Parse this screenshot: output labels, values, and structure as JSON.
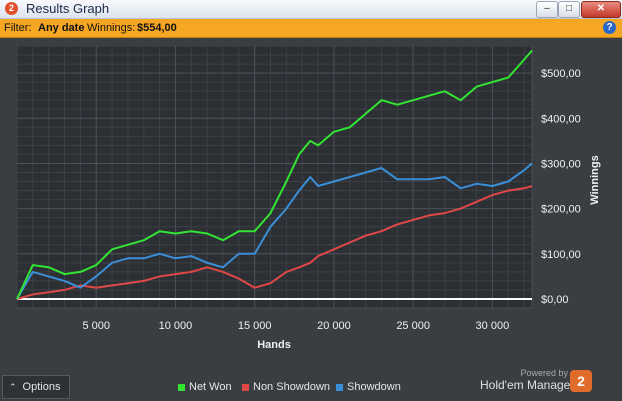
{
  "window": {
    "app_badge": "2",
    "title": "Results Graph",
    "minimize": "‒",
    "maximize": "□",
    "close": "✕"
  },
  "filter": {
    "label": "Filter:",
    "date_value": "Any date",
    "winnings_label": "Winnings:",
    "winnings_value": "$554,00",
    "help": "?"
  },
  "bottom": {
    "options_label": "Options",
    "powered_by": "Powered by",
    "brand": "Hold'em Manager",
    "brand_badge": "2"
  },
  "colors": {
    "net_won": "#33e533",
    "non_showdown": "#e04848",
    "showdown": "#3a8fd8"
  },
  "chart_data": {
    "type": "line",
    "xlabel": "Hands",
    "ylabel": "Winnings",
    "xlim": [
      0,
      32500
    ],
    "ylim": [
      -20,
      560
    ],
    "x_ticks": [
      5000,
      10000,
      15000,
      20000,
      25000,
      30000
    ],
    "x_tick_labels": [
      "5 000",
      "10 000",
      "15 000",
      "20 000",
      "25 000",
      "30 000"
    ],
    "y_ticks": [
      0,
      100,
      200,
      300,
      400,
      500
    ],
    "y_tick_labels": [
      "$0,00",
      "$100,00",
      "$200,00",
      "$300,00",
      "$400,00",
      "$500,00"
    ],
    "grid": true,
    "legend_position": "bottom",
    "x": [
      0,
      1000,
      2000,
      3000,
      4000,
      5000,
      6000,
      7000,
      8000,
      9000,
      10000,
      11000,
      12000,
      13000,
      14000,
      15000,
      16000,
      17000,
      17800,
      18500,
      19000,
      20000,
      21000,
      22000,
      23000,
      24000,
      25000,
      26000,
      27000,
      28000,
      29000,
      30000,
      31000,
      32000,
      32500
    ],
    "series": [
      {
        "name": "Net Won",
        "values": [
          0,
          75,
          70,
          55,
          60,
          75,
          110,
          120,
          130,
          150,
          145,
          150,
          145,
          130,
          150,
          150,
          190,
          260,
          320,
          350,
          340,
          370,
          380,
          410,
          440,
          430,
          440,
          450,
          460,
          440,
          470,
          480,
          490,
          530,
          550
        ]
      },
      {
        "name": "Non Showdown",
        "values": [
          0,
          10,
          15,
          20,
          30,
          25,
          30,
          35,
          40,
          50,
          55,
          60,
          70,
          60,
          45,
          25,
          35,
          60,
          70,
          80,
          95,
          110,
          125,
          140,
          150,
          165,
          175,
          185,
          190,
          200,
          215,
          230,
          240,
          245,
          250
        ]
      },
      {
        "name": "Showdown",
        "values": [
          0,
          60,
          50,
          40,
          25,
          50,
          80,
          90,
          90,
          100,
          90,
          95,
          80,
          70,
          100,
          100,
          160,
          200,
          240,
          270,
          250,
          260,
          270,
          280,
          290,
          265,
          265,
          265,
          270,
          245,
          255,
          250,
          260,
          285,
          300
        ]
      }
    ]
  }
}
